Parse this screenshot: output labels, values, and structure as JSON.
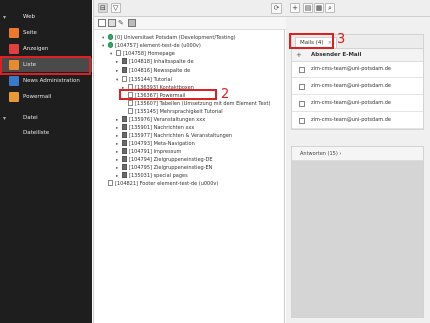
{
  "module_menu": {
    "groups": [
      {
        "title": "Web",
        "items": [
          "Seite",
          "Anzeigen",
          "Liste",
          "News Administration",
          "Powermail"
        ]
      },
      {
        "title": "Datei",
        "items": [
          "Dateiliste"
        ]
      }
    ],
    "active_item": "Liste"
  },
  "annotations": {
    "one": "1",
    "two": "2",
    "three": "3"
  },
  "page_tree": {
    "nodes": [
      "[0] Universitaet Potsdam (Development/Testing)",
      "[104757] element-test-de (u000v)",
      "[104758] Homepage",
      "[104818] Inhaltsspalte de",
      "[104816] Newsspalte de",
      "[135144] Tutorial",
      "[136393] Kontaktboxen",
      "[136367] Powermail",
      "[135607] Tabellen (Umsetzung mit dem Element Text)",
      "[135145] Mehrsprachigkeit Tutorial",
      "[135976] Veranstaltungen xxx",
      "[135901] Nachrichten xxx",
      "[135977] Nachrichten & Veranstaltungen",
      "[104793] Meta-Navigation",
      "[104791] Impressum",
      "[104794] Zielgruppeneinstieg-DE",
      "[104795] Zielgruppeneinstieg-EN",
      "[135031] special pages",
      "[104821] Footer element-test-de (u000v)"
    ]
  },
  "right_panel": {
    "tab_label": "Mails (4)",
    "tab_close": "×",
    "column_header": "Absender E-Mail",
    "mails": [
      "zim-cms-team@uni-potsdam.de",
      "zim-cms-team@uni-potsdam.de",
      "zim-cms-team@uni-potsdam.de",
      "zim-cms-team@uni-potsdam.de"
    ],
    "answers_label": "Antworten (15)",
    "answers_chevron": "›"
  },
  "colors": {
    "seite": "#f0782a",
    "anzeigen": "#e04040",
    "liste": "#e88a30",
    "news": "#3a78c8",
    "powermail": "#e89a30",
    "annotation": "#e02020"
  }
}
